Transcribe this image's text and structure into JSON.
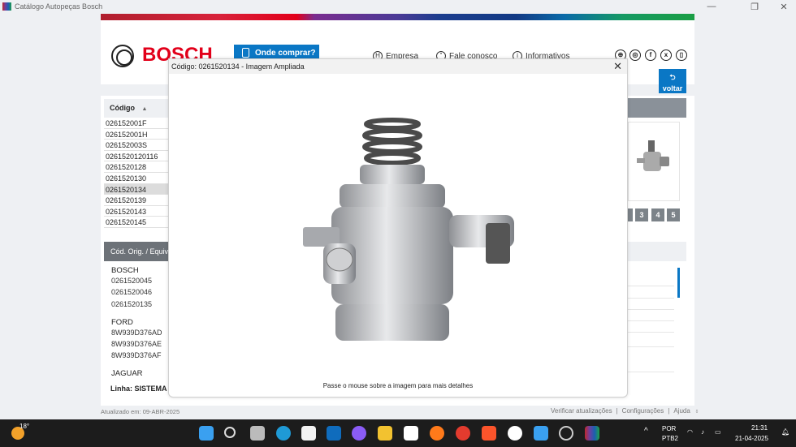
{
  "window": {
    "title": "Catálogo Autopeças Bosch",
    "min": "—",
    "max": "❐",
    "close": "✕"
  },
  "header": {
    "brand": "BOSCH",
    "buy_button": "Onde comprar?",
    "nav": [
      "Empresa",
      "Fale conosco",
      "Informativos"
    ],
    "social": [
      "globe-icon",
      "instagram-icon",
      "facebook-icon",
      "x-icon",
      "mobile-icon"
    ],
    "voltar": "voltar"
  },
  "codes": {
    "header": "Código",
    "sort": "▲",
    "items": [
      "026152001F",
      "026152001H",
      "026152003S",
      "026152012​0116",
      "0261520128",
      "0261520130",
      "0261520134",
      "0261520139",
      "0261520143",
      "0261520145"
    ],
    "selected": "0261520134"
  },
  "pagination": [
    "3",
    "4",
    "5"
  ],
  "equivalents": {
    "header": "Cód. Orig. / Equivalentes",
    "groups": [
      {
        "brand": "BOSCH",
        "codes": [
          "0261520045",
          "0261520046",
          "0261520135"
        ]
      },
      {
        "brand": "FORD",
        "codes": [
          "8W939D376AD",
          "8W939D376AE",
          "8W939D376AF"
        ]
      },
      {
        "brand": "JAGUAR",
        "codes": []
      }
    ],
    "linha": "Linha:  SISTEMA D"
  },
  "modal": {
    "title": "Código: 0261520134 - Imagem Ampliada",
    "close": "✕",
    "caption": "Passe o mouse sobre a imagem para mais detalhes"
  },
  "footer": {
    "updated": "Atualizado em: 09-ABR-2025",
    "links": [
      "Verificar atualizações",
      "Configurações",
      "Ajuda"
    ],
    "sep": "|"
  },
  "taskbar": {
    "weather": "18°",
    "lang": "POR",
    "layout": "PTB2",
    "time": "21:31",
    "date": "21-04-2025"
  },
  "colors": {
    "accent": "#0a77c5",
    "brand": "#e2001a"
  }
}
